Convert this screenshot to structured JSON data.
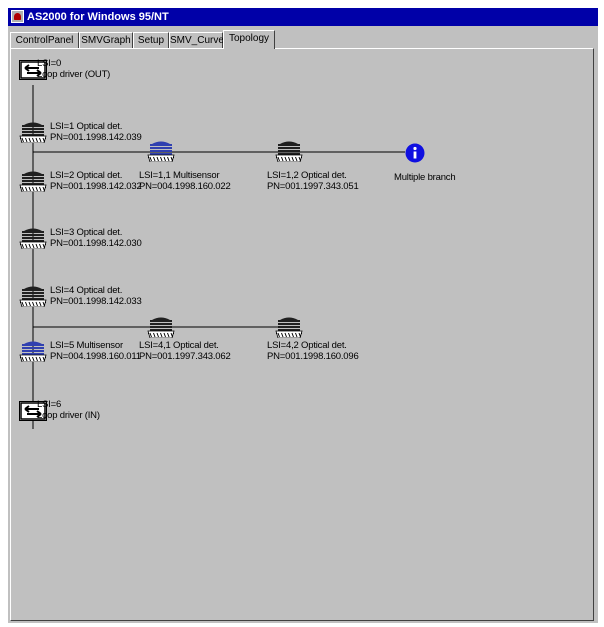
{
  "window": {
    "title": "AS2000 for Windows 95/NT"
  },
  "tabs": [
    {
      "label": "ControlPanel",
      "active": false
    },
    {
      "label": "SMVGraph",
      "active": false
    },
    {
      "label": "Setup",
      "active": false
    },
    {
      "label": "SMV_Curves",
      "active": false
    },
    {
      "label": "Topology",
      "active": true
    }
  ],
  "topology": {
    "nodes": [
      {
        "id": "lsi0",
        "type": "loop-driver",
        "line1": "LSI=0",
        "line2": "Loop driver (OUT)"
      },
      {
        "id": "lsi1",
        "type": "optical",
        "line1": "LSI=1 Optical det.",
        "line2": "PN=001.1998.142.039"
      },
      {
        "id": "lsi1_1",
        "type": "multisensor",
        "line1": "LSI=1,1 Multisensor",
        "line2": "PN=004.1998.160.022"
      },
      {
        "id": "lsi1_2",
        "type": "optical",
        "line1": "LSI=1,2 Optical det.",
        "line2": "PN=001.1997.343.051"
      },
      {
        "id": "branch",
        "type": "info",
        "line1": "Multiple branch",
        "line2": ""
      },
      {
        "id": "lsi2",
        "type": "optical",
        "line1": "LSI=2 Optical det.",
        "line2": "PN=001.1998.142.032"
      },
      {
        "id": "lsi3",
        "type": "optical",
        "line1": "LSI=3 Optical det.",
        "line2": "PN=001.1998.142.030"
      },
      {
        "id": "lsi4",
        "type": "optical",
        "line1": "LSI=4 Optical det.",
        "line2": "PN=001.1998.142.033"
      },
      {
        "id": "lsi4_1",
        "type": "optical",
        "line1": "LSI=4,1 Optical det.",
        "line2": "PN=001.1997.343.062"
      },
      {
        "id": "lsi4_2",
        "type": "optical",
        "line1": "LSI=4,2 Optical det.",
        "line2": "PN=001.1998.160.096"
      },
      {
        "id": "lsi5",
        "type": "multisensor",
        "line1": "LSI=5 Multisensor",
        "line2": "PN=004.1998.160.011"
      },
      {
        "id": "lsi6",
        "type": "loop-driver",
        "line1": "LSI=6",
        "line2": "Loop driver (IN)"
      }
    ]
  },
  "colors": {
    "titlebar": "#0000a8",
    "multisensor": "#3040b0",
    "info": "#1010e0",
    "detector": "#202020"
  }
}
